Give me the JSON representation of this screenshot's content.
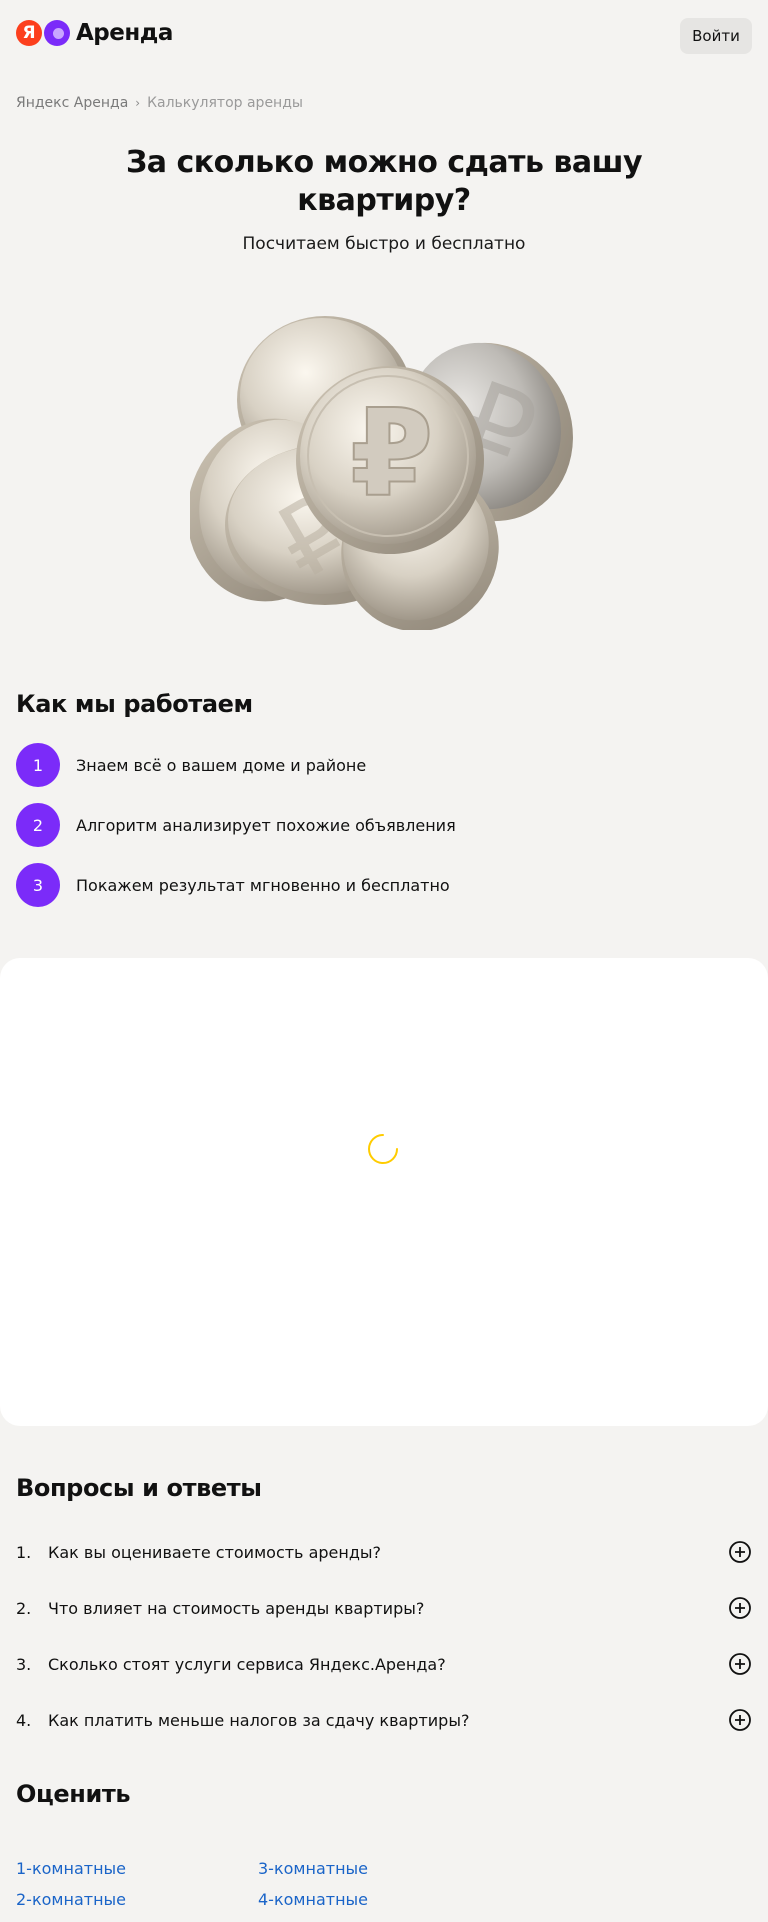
{
  "header": {
    "logo_letter": "Я",
    "logo_text": "Аренда",
    "login_label": "Войти"
  },
  "breadcrumb": {
    "root": "Яндекс Аренда",
    "current": "Калькулятор аренды"
  },
  "hero": {
    "title": "За сколько можно сдать вашу квартиру?",
    "subtitle": "Посчитаем быстро и бесплатно"
  },
  "how_we_work": {
    "title": "Как мы работаем",
    "steps": [
      {
        "num": "1",
        "text": "Знаем всё о вашем доме и районе"
      },
      {
        "num": "2",
        "text": "Алгоритм анализирует похожие объявления"
      },
      {
        "num": "3",
        "text": "Покажем результат мгновенно и бесплатно"
      }
    ]
  },
  "calculator": {
    "status": "loading",
    "spinner_color": "#ffcc00"
  },
  "faq": {
    "title": "Вопросы и ответы",
    "items": [
      {
        "num": "1.",
        "question": "Как вы оцениваете стоимость аренды?"
      },
      {
        "num": "2.",
        "question": "Что влияет на стоимость аренды квартиры?"
      },
      {
        "num": "3.",
        "question": "Сколько стоят услуги сервиса Яндекс.Аренда?"
      },
      {
        "num": "4.",
        "question": "Как платить меньше налогов за сдачу квартиры?"
      }
    ]
  },
  "rate": {
    "title": "Оценить",
    "links": [
      "1-комнатные",
      "2-комнатные",
      "3-комнатные",
      "4-комнатные"
    ]
  },
  "colors": {
    "accent": "#7b2bf9",
    "brand_red": "#fc3f1d",
    "link": "#1a64c8",
    "background": "#f4f3f1"
  }
}
